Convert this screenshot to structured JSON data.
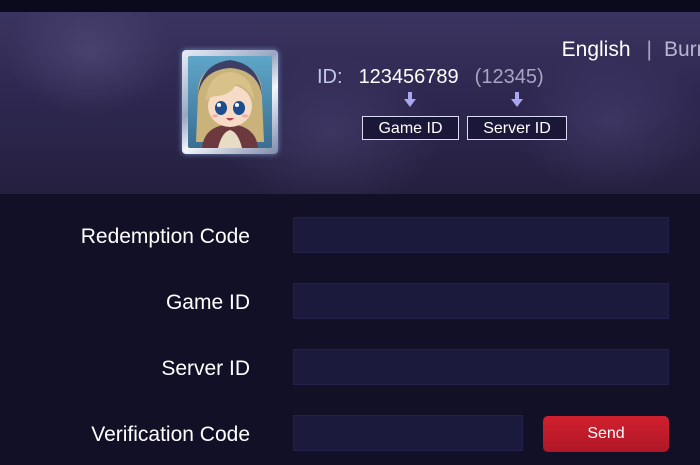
{
  "header": {
    "language_current": "English",
    "language_next": "Burmese"
  },
  "profile": {
    "avatar_icon": "hero-avatar-icon",
    "id_label": "ID:",
    "game_id_value": "123456789",
    "server_id_value": "(12345)",
    "game_id_tag": "Game ID",
    "server_id_tag": "Server ID"
  },
  "form": {
    "redemption_code_label": "Redemption Code",
    "redemption_code_value": "",
    "game_id_label": "Game ID",
    "game_id_value": "",
    "server_id_label": "Server ID",
    "server_id_value": "",
    "verification_code_label": "Verification Code",
    "verification_code_value": "",
    "send_label": "Send"
  },
  "colors": {
    "background": "#121027",
    "banner": "#2e2851",
    "input_background": "#1c1a3c",
    "send_button": "#c41b2b",
    "arrow": "#a9a6f2"
  }
}
